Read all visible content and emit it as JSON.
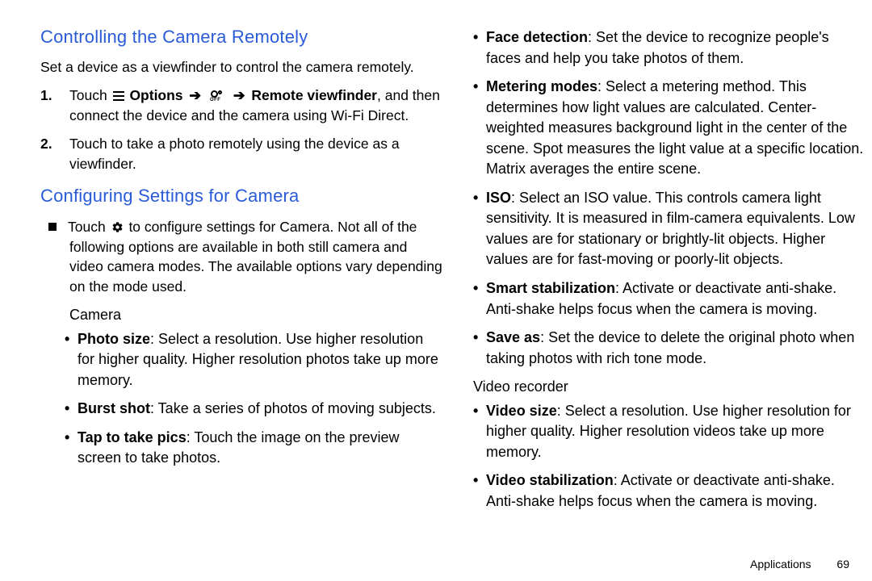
{
  "left": {
    "h1": "Controlling the Camera Remotely",
    "intro": "Set a device as a viewfinder to control the camera remotely.",
    "step1_num": "1.",
    "step1_a": "Touch ",
    "step1_opts": " Options",
    "step1_b": " Remote viewfinder",
    "step1_c": ", and then connect the device and the camera using Wi-Fi Direct.",
    "step2_num": "2.",
    "step2": "Touch to take a photo remotely using the device as a viewfinder.",
    "h2": "Configuring Settings for Camera",
    "cfg_a": "Touch ",
    "cfg_b": " to configure settings for Camera. Not all of the following options are available in both still camera and video camera modes. The available options vary depending on the mode used.",
    "camera_label": "Camera",
    "photo_size_b": "Photo size",
    "photo_size_t": ": Select a resolution. Use higher resolution for higher quality. Higher resolution photos take up more memory.",
    "burst_b": "Burst shot",
    "burst_t": ": Take a series of photos of moving subjects.",
    "tap_b": "Tap to take pics",
    "tap_t": ": Touch the image on the preview screen to take photos."
  },
  "right": {
    "face_b": "Face detection",
    "face_t": ": Set the device to recognize people's faces and help you take photos of them.",
    "meter_b": "Metering modes",
    "meter_t": ": Select a metering method. This determines how light values are calculated. Center-weighted measures background light in the center of the scene. Spot measures the light value at a specific location. Matrix averages the entire scene.",
    "iso_b": "ISO",
    "iso_t": ": Select an ISO value. This controls camera light sensitivity. It is measured in film-camera equivalents. Low values are for stationary or brightly-lit objects. Higher values are for fast-moving or poorly-lit objects.",
    "stab_b": "Smart stabilization",
    "stab_t": ": Activate or deactivate anti-shake. Anti-shake helps focus when the camera is moving.",
    "save_b": "Save as",
    "save_t": ": Set the device to delete the original photo when taking photos with rich tone mode.",
    "video_label": "Video recorder",
    "vsize_b": "Video size",
    "vsize_t": ": Select a resolution. Use higher resolution for higher quality. Higher resolution videos take up more memory.",
    "vstab_b": "Video stabilization",
    "vstab_t": ": Activate or deactivate anti-shake. Anti-shake helps focus when the camera is moving."
  },
  "footer": {
    "section": "Applications",
    "page": "69"
  }
}
